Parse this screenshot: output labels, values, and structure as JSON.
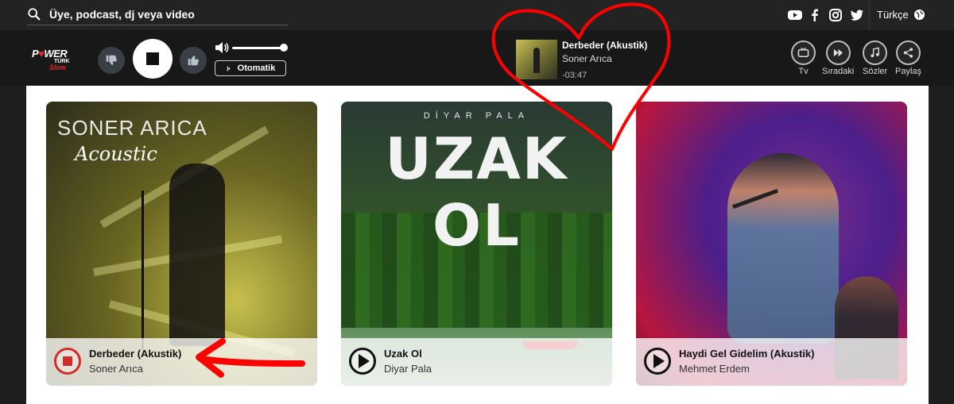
{
  "topbar": {
    "search_placeholder": "Üye, podcast, dj veya video",
    "social_icons": [
      "youtube-icon",
      "facebook-icon",
      "instagram-icon",
      "twitter-icon"
    ],
    "language": "Türkçe"
  },
  "player": {
    "logo": {
      "line1a": "P",
      "heart": "♥",
      "line1b": "WER",
      "line2": "TÜRK",
      "line3": "Slow"
    },
    "auto_label": "Otomatik",
    "volume_level": 0.9,
    "now_playing": {
      "title": "Derbeder (Akustik)",
      "artist": "Soner Arıca",
      "time": "-03:47"
    },
    "tools": [
      {
        "label": "Tv",
        "icon": "tv-icon"
      },
      {
        "label": "Sıradaki",
        "icon": "next-icon"
      },
      {
        "label": "Sözler",
        "icon": "lyrics-icon"
      },
      {
        "label": "Paylaş",
        "icon": "share-icon"
      }
    ]
  },
  "cards": [
    {
      "art_line1": "SONER ARICA",
      "art_line2": "Acoustic",
      "title": "Derbeder (Akustik)",
      "artist": "Soner Arıca",
      "state": "playing"
    },
    {
      "art_line1": "DİYAR PALA",
      "art_line2": "UZAK OL",
      "title": "Uzak Ol",
      "artist": "Diyar Pala",
      "state": "paused"
    },
    {
      "title": "Haydi Gel Gidelim (Akustik)",
      "artist": "Mehmet Erdem",
      "state": "paused"
    }
  ],
  "annotations": {
    "heart_color": "#ff0000",
    "arrow_color": "#ff0000"
  },
  "colors": {
    "accent_red": "#d52a2a",
    "topbar_bg": "#232323",
    "player_bg": "#181818"
  }
}
